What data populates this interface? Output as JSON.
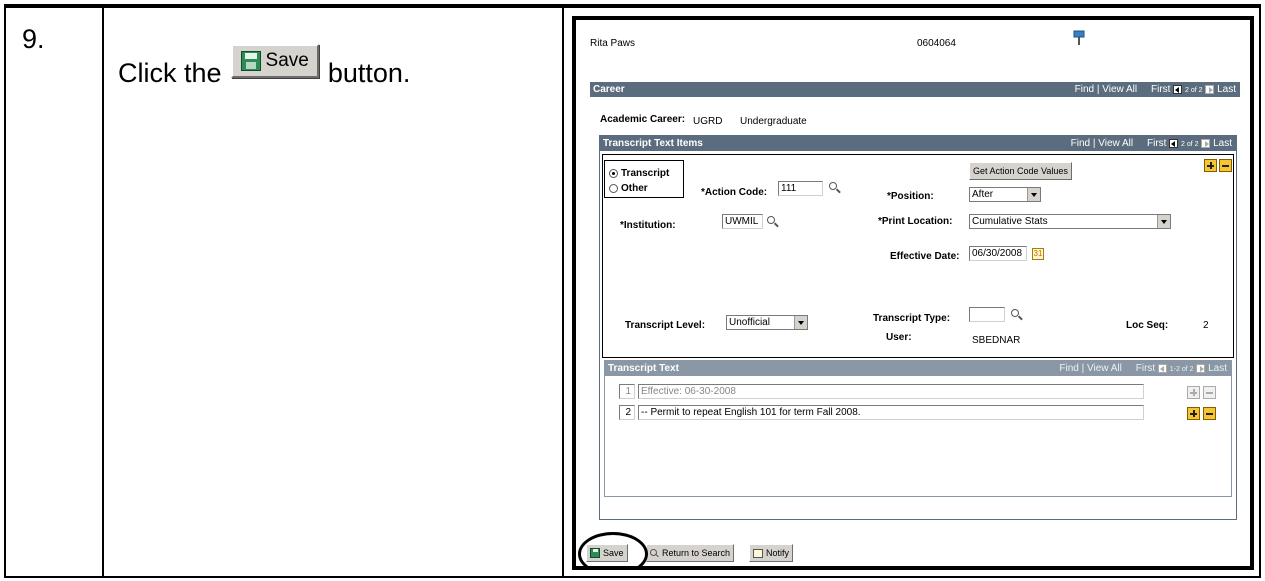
{
  "step": {
    "number": "9.",
    "text_before": "Click the",
    "text_after": "button.",
    "button_label": "Save"
  },
  "screen": {
    "student_name": "Rita Paws",
    "student_id": "0604064",
    "career_bar": {
      "title": "Career",
      "find": "Find",
      "view_all": "View All",
      "first": "First",
      "counter": "2 of 2",
      "last": "Last"
    },
    "academic_career": {
      "label": "Academic Career:",
      "code": "UGRD",
      "description": "Undergraduate"
    },
    "items_bar": {
      "title": "Transcript Text Items",
      "find": "Find",
      "view_all": "View All",
      "first": "First",
      "counter": "2 of 2",
      "last": "Last"
    },
    "radio_transcript": "Transcript",
    "radio_other": "Other",
    "get_action_button": "Get Action Code Values",
    "action_code": {
      "label": "*Action Code:",
      "value": "111"
    },
    "position": {
      "label": "*Position:",
      "value": "After"
    },
    "institution": {
      "label": "*Institution:",
      "value": "UWMIL"
    },
    "print_location": {
      "label": "*Print Location:",
      "value": "Cumulative Stats"
    },
    "effective_date": {
      "label": "Effective Date:",
      "value": "06/30/2008"
    },
    "transcript_level": {
      "label": "Transcript Level:",
      "value": "Unofficial"
    },
    "transcript_type": {
      "label": "Transcript Type:",
      "value": ""
    },
    "user": {
      "label": "User:",
      "value": "SBEDNAR"
    },
    "loc_seq": {
      "label": "Loc Seq:",
      "value": "2"
    },
    "text_bar": {
      "title": "Transcript Text",
      "find": "Find",
      "view_all": "View All",
      "first": "First",
      "counter": "1-2 of 2",
      "last": "Last"
    },
    "text_rows": [
      {
        "seq": "1",
        "text": "Effective: 06-30-2008"
      },
      {
        "seq": "2",
        "text": "-- Permit to repeat English 101 for term  Fall 2008."
      }
    ],
    "toolbar": {
      "save": "Save",
      "return_to_search": "Return to Search",
      "notify": "Notify"
    }
  }
}
